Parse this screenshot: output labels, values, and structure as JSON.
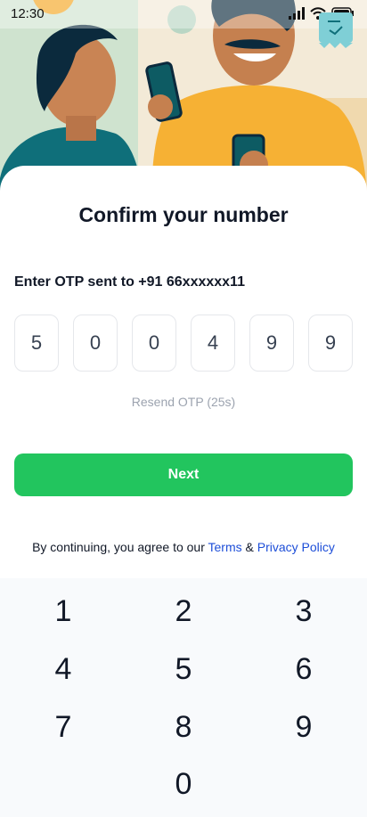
{
  "status_bar": {
    "time": "12:30"
  },
  "screen": {
    "title": "Confirm your number"
  },
  "otp": {
    "prompt": "Enter OTP sent to +91 66xxxxxx11",
    "digits": [
      "5",
      "0",
      "0",
      "4",
      "9",
      "9"
    ],
    "resend": "Resend OTP (25s)"
  },
  "actions": {
    "next_label": "Next"
  },
  "terms": {
    "prefix": "By continuing, you agree to our ",
    "terms_link": "Terms",
    "amp": " & ",
    "privacy_link": "Privacy Policy"
  },
  "keypad": {
    "keys": [
      "1",
      "2",
      "3",
      "4",
      "5",
      "6",
      "7",
      "8",
      "9",
      "0"
    ]
  },
  "colors": {
    "accent_green": "#22c55e",
    "link_blue": "#1d4ed8",
    "hero_orange": "#f5a623"
  },
  "icons": [
    "signal-icon",
    "wifi-icon",
    "battery-icon",
    "app-ticket-icon"
  ]
}
